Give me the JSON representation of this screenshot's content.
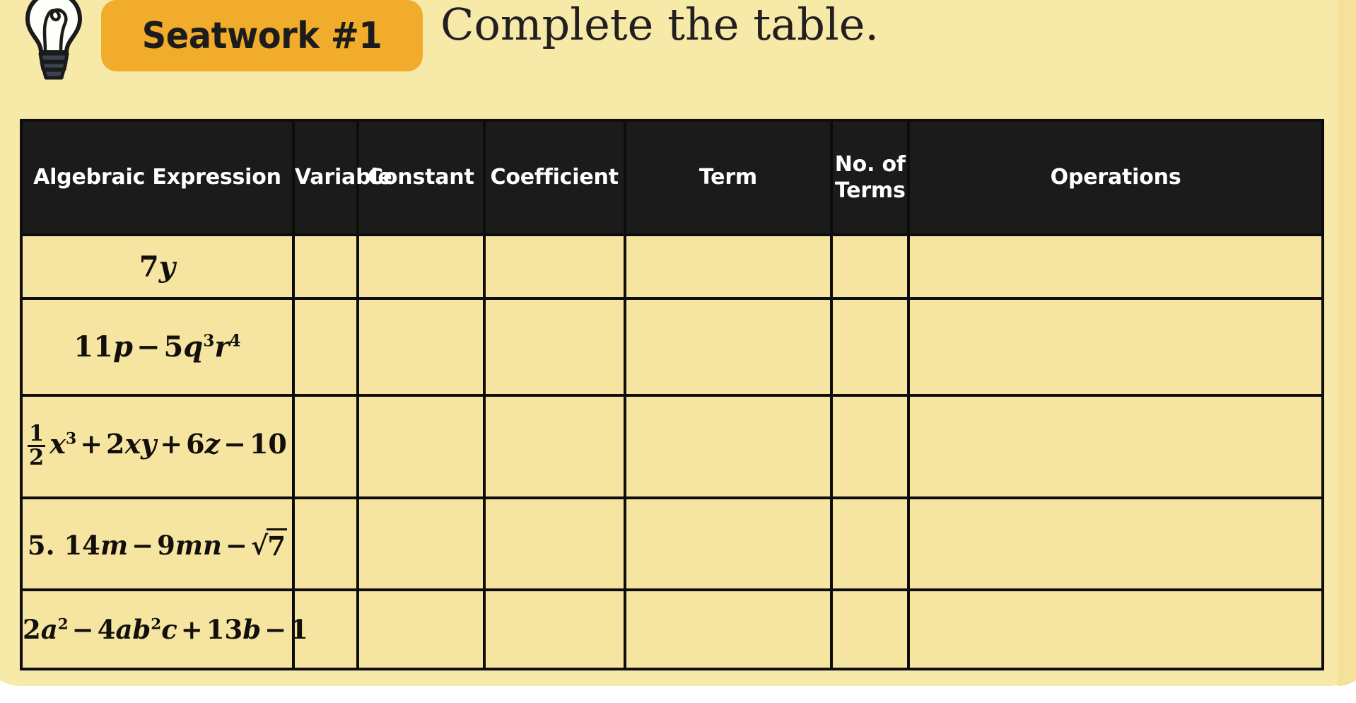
{
  "page": {
    "background_color": "#F7E9A8",
    "card_color": "#F7E9A8"
  },
  "header": {
    "badge_label": "Seatwork #1",
    "badge_color": "#F0AC2A",
    "instruction": "Complete the table.",
    "icon": "lightbulb-icon"
  },
  "table": {
    "header_bg": "#1B1B1B",
    "header_text_color": "#FFFFFF",
    "cell_bg": "#F5E5A0",
    "border_color": "#0E0D0D",
    "columns": [
      {
        "key": "expression",
        "label": "Algebraic Expression"
      },
      {
        "key": "variable",
        "label": "Variable"
      },
      {
        "key": "constant",
        "label": "Constant"
      },
      {
        "key": "coefficient",
        "label": "Coefficient"
      },
      {
        "key": "term",
        "label": "Term"
      },
      {
        "key": "no_of_terms",
        "label": "No. of Terms"
      },
      {
        "key": "operations",
        "label": "Operations"
      }
    ],
    "rows": [
      {
        "expression_text": "7y",
        "variable": "",
        "constant": "",
        "coefficient": "",
        "term": "",
        "no_of_terms": "",
        "operations": ""
      },
      {
        "expression_text": "11p − 5q³r⁴",
        "variable": "",
        "constant": "",
        "coefficient": "",
        "term": "",
        "no_of_terms": "",
        "operations": ""
      },
      {
        "expression_text": "1/2 x³ + 2xy + 6z − 10",
        "variable": "",
        "constant": "",
        "coefficient": "",
        "term": "",
        "no_of_terms": "",
        "operations": ""
      },
      {
        "expression_text": "5. 14m − 9mn − √7",
        "variable": "",
        "constant": "",
        "coefficient": "",
        "term": "",
        "no_of_terms": "",
        "operations": ""
      },
      {
        "expression_text": "2a² − 4ab²c + 13b − 1",
        "variable": "",
        "constant": "",
        "coefficient": "",
        "term": "",
        "no_of_terms": "",
        "operations": ""
      }
    ],
    "expression_parts": {
      "row1": {
        "coef": "7",
        "var": "y"
      },
      "row2": {
        "coef1": "11",
        "var1": "p",
        "op1": "−",
        "coef2": "5",
        "var2": "q",
        "pow2": "3",
        "var3": "r",
        "pow3": "4"
      },
      "row3": {
        "frac_num": "1",
        "frac_den": "2",
        "var1": "x",
        "pow1": "3",
        "op1": "+",
        "coef2": "2",
        "var2": "xy",
        "op2": "+",
        "coef3": "6",
        "var3": "z",
        "op3": "−",
        "const": "10"
      },
      "row4": {
        "index": "5.",
        "coef1": "14",
        "var1": "m",
        "op1": "−",
        "coef2": "9",
        "var2": "mn",
        "op2": "−",
        "radicand": "7"
      },
      "row5": {
        "coef1": "2",
        "var1": "a",
        "pow1": "2",
        "op1": "−",
        "coef2": "4",
        "var2": "a",
        "var2b": "b",
        "pow2": "2",
        "var2c": "c",
        "op2": "+",
        "coef3": "13",
        "var3": "b",
        "op3": "−",
        "const": "1"
      }
    }
  }
}
